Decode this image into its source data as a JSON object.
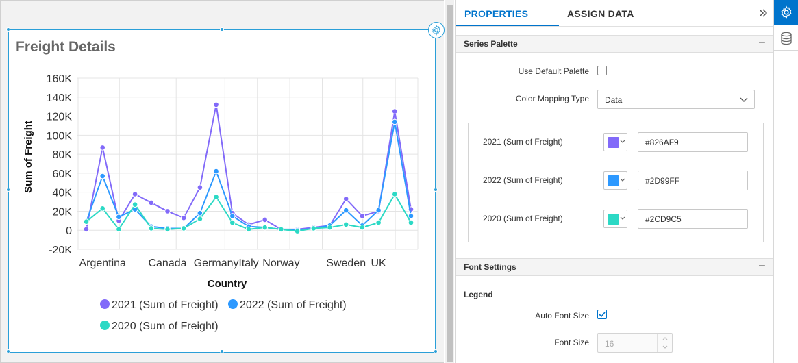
{
  "widget": {
    "title": "Freight Details"
  },
  "chart_data": {
    "type": "line",
    "xlabel": "Country",
    "ylabel": "Sum of Freight",
    "ylim": [
      -20000,
      160000
    ],
    "yticks": [
      -20000,
      0,
      20000,
      40000,
      60000,
      80000,
      100000,
      120000,
      140000,
      160000
    ],
    "ytick_labels": [
      "-20K",
      "0",
      "20K",
      "40K",
      "60K",
      "80K",
      "100K",
      "120K",
      "140K",
      "160K"
    ],
    "xtick_labels": [
      "Argentina",
      "Canada",
      "Germany",
      "Italy",
      "Norway",
      "Sweden",
      "UK"
    ],
    "xtick_index": [
      1,
      5,
      8,
      10,
      12,
      16,
      18
    ],
    "point_count": 21,
    "grid": true,
    "legend_position": "bottom",
    "series": [
      {
        "name": "2021 (Sum of Freight)",
        "color": "#826AF9",
        "values": [
          1000,
          87000,
          10000,
          38000,
          29000,
          20000,
          13000,
          45000,
          132000,
          18000,
          6000,
          11000,
          1000,
          1000,
          3000,
          5000,
          33000,
          15000,
          20000,
          125000,
          22000
        ]
      },
      {
        "name": "2022 (Sum of Freight)",
        "color": "#2D99FF",
        "values": [
          9000,
          57000,
          14000,
          22000,
          4000,
          2000,
          2000,
          18000,
          62000,
          15000,
          4000,
          3000,
          1000,
          0,
          2000,
          5000,
          21000,
          5000,
          21000,
          114000,
          15000
        ]
      },
      {
        "name": "2020 (Sum of Freight)",
        "color": "#2CD9C5",
        "values": [
          9000,
          23000,
          1000,
          27000,
          2000,
          1000,
          2000,
          12000,
          35000,
          8000,
          1000,
          3000,
          1000,
          -1000,
          2000,
          3000,
          6000,
          3000,
          8000,
          38000,
          8000
        ]
      }
    ]
  },
  "panel": {
    "tabs": [
      "PROPERTIES",
      "ASSIGN DATA"
    ],
    "collapse_icon": "chevrons-right-icon",
    "series_palette": {
      "title": "Series Palette",
      "use_default_label": "Use Default Palette",
      "use_default_checked": false,
      "mapping_label": "Color Mapping Type",
      "mapping_value": "Data",
      "entries": [
        {
          "label": "2021 (Sum of Freight)",
          "color": "#826AF9",
          "hex": "#826AF9"
        },
        {
          "label": "2022 (Sum of Freight)",
          "color": "#2D99FF",
          "hex": "#2D99FF"
        },
        {
          "label": "2020 (Sum of Freight)",
          "color": "#2CD9C5",
          "hex": "#2CD9C5"
        }
      ]
    },
    "font_settings": {
      "title": "Font Settings",
      "legend_label": "Legend",
      "auto_font_label": "Auto Font Size",
      "auto_font_checked": true,
      "font_size_label": "Font Size",
      "font_size_value": "16"
    }
  },
  "sidebar": {
    "buttons": [
      "gear-icon",
      "database-icon"
    ]
  },
  "colors": {
    "accent": "#0074cc",
    "widget_border": "#2a9fd8"
  }
}
